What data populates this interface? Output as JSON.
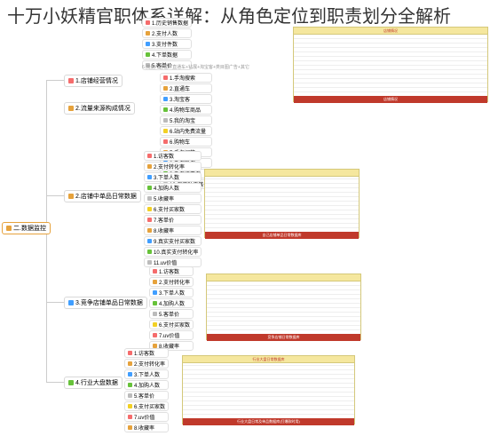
{
  "title": "十万小妖精官职体系详解：从角色定位到职责划分全解析",
  "root": "二.数据监控",
  "branch1": {
    "label": "1.店铺经营情况",
    "sub": "2.流量来源构成情况",
    "topLeaves": [
      "1.历史销售数据",
      "2.支付人数",
      "3.支付件数",
      "4.下单数据",
      "5.客单价"
    ],
    "flowDesc": "6.流量广告位：直通车+钻展+淘宝客+类目图广告+其它",
    "flowLeaves": [
      "1.手淘搜索",
      "2.直通车",
      "3.淘宝客",
      "4.购物车商品",
      "5.我的淘宝",
      "6.站内免费流量",
      "6.购物车",
      "7.手淘问答",
      "8.手淘微淘",
      "9.手淘拍立淘",
      "10.淘宝站内其他"
    ]
  },
  "branch2": {
    "label": "2.店铺中单品日常数据",
    "leaves": [
      "1.访客数",
      "2.支付转化率",
      "3.下单人数",
      "4.加购人数",
      "5.收藏率",
      "6.支付买家数",
      "7.客单价",
      "8.收藏率",
      "9.真实支付买家数",
      "10.真实支付转化率",
      "11.uv价值"
    ]
  },
  "branch3": {
    "label": "3.竞争店铺单品日常数据",
    "leaves": [
      "1.访客数",
      "2.支付转化率",
      "3.下单人数",
      "4.加购人数",
      "5.客单价",
      "6.支付买家数",
      "7.uv价值",
      "8.收藏率"
    ]
  },
  "branch4": {
    "label": "4.行业大盘数据",
    "leaves": [
      "1.访客数",
      "2.支付转化率",
      "3.下单人数",
      "4.加购人数",
      "5.客单价",
      "6.支付买家数",
      "7.uv价值",
      "8.收藏率"
    ]
  },
  "tables": {
    "t1": {
      "head": "店铺情况",
      "foot": "店铺情况"
    },
    "t2": {
      "head": "",
      "foot": "自己店铺单品日常数据库"
    },
    "t3": {
      "head": "",
      "foot": "竞争店铺日常数据库"
    },
    "t4": {
      "head": "行业大盘日常数据库",
      "foot": "行业大盘日常及单品数据库(打爆款时用)"
    }
  }
}
